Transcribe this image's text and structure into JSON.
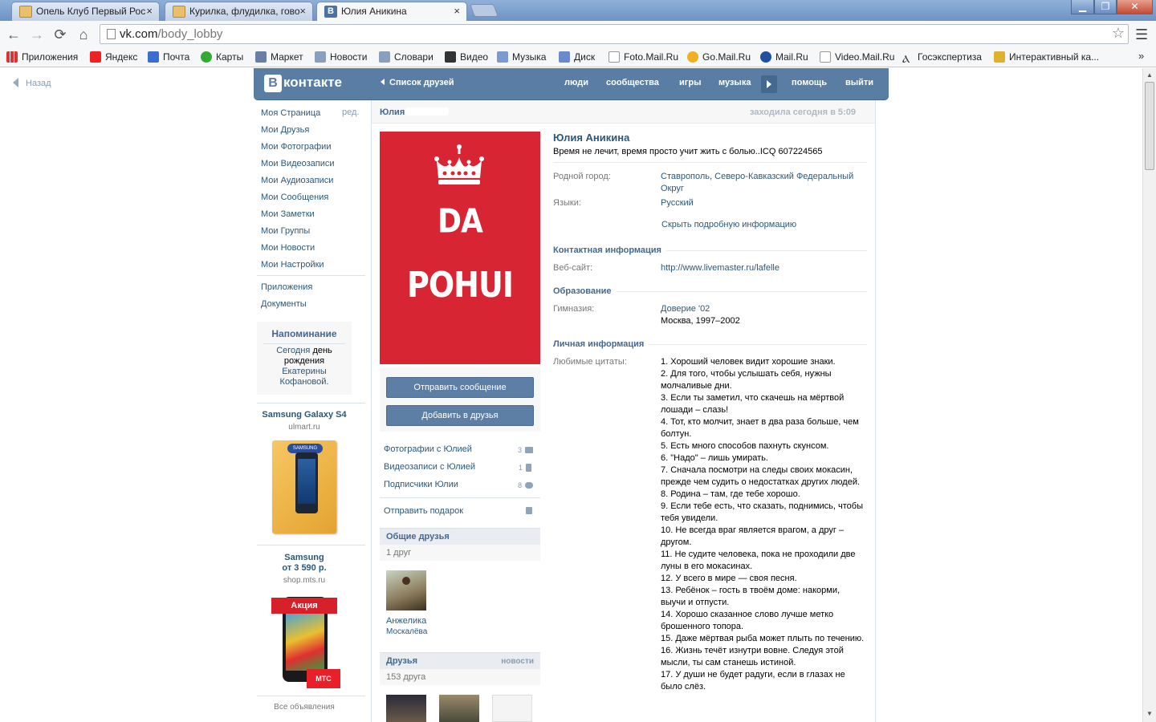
{
  "browser": {
    "tabs": [
      {
        "title": "Опель Клуб Первый Рос"
      },
      {
        "title": "Курилка, флудилка, гово"
      },
      {
        "title": "Юлия Аникина"
      }
    ],
    "url_host": "vk.com",
    "url_path": "/body_lobby",
    "bookmarks": [
      "Приложения",
      "Яндекс",
      "Почта",
      "Карты",
      "Маркет",
      "Новости",
      "Словари",
      "Видео",
      "Музыка",
      "Диск",
      "Foto.Mail.Ru",
      "Go.Mail.Ru",
      "Mail.Ru",
      "Video.Mail.Ru",
      "Госэкспертиза",
      "Интерактивный ка..."
    ],
    "bookmarks_more": "»"
  },
  "page": {
    "back_label": "Назад",
    "logo_text": "контакте",
    "logo_letter": "В",
    "friends_list_link": "Список друзей",
    "top_nav": [
      "люди",
      "сообщества",
      "игры",
      "музыка",
      "помощь",
      "выйти"
    ],
    "left_nav": [
      "Моя Страница",
      "Мои Друзья",
      "Мои Фотографии",
      "Мои Видеозаписи",
      "Мои Аудиозаписи",
      "Мои Сообщения",
      "Мои Заметки",
      "Мои Группы",
      "Мои Новости",
      "Мои Настройки"
    ],
    "edit_link": "ред.",
    "left_nav_extra": [
      "Приложения",
      "Документы"
    ],
    "reminder": {
      "title": "Напоминание",
      "today": "Сегодня",
      "text": "день рождения",
      "name1": "Екатерины",
      "name2": "Кофановой."
    },
    "ads": [
      {
        "title": "Samsung Galaxy S4",
        "domain": "ulmart.ru",
        "brand": "SAMSUNG"
      },
      {
        "title_line1": "Samsung",
        "title_line2": "от 3 590 р.",
        "domain": "shop.mts.ru",
        "banner": "Акция",
        "mts": "МТС"
      }
    ],
    "all_ads": "Все объявления",
    "crumb_name": "Юлия",
    "last_seen": "заходила сегодня в 5:09",
    "avatar_text": [
      "DA",
      "POHUI"
    ],
    "buttons": {
      "message": "Отправить сообщение",
      "add_friend": "Добавить в друзья"
    },
    "side_links": [
      {
        "label": "Фотографии с Юлией",
        "count": "3"
      },
      {
        "label": "Видеозаписи с Юлией",
        "count": "1"
      },
      {
        "label": "Подписчики Юлии",
        "count": "8"
      }
    ],
    "gift_link": "Отправить подарок",
    "mutual": {
      "title": "Общие друзья",
      "count": "1 друг",
      "friend_first": "Анжелика",
      "friend_last": "Москалёва"
    },
    "friends": {
      "title": "Друзья",
      "right": "новости",
      "count": "153 друга"
    },
    "profile": {
      "name": "Юлия Аникина",
      "status": "Время не лечит, время просто учит жить с болью..ICQ 607224565",
      "hometown_label": "Родной город:",
      "hometown_line1": "Ставрополь, Северо-Кавказский Федеральный",
      "hometown_line2": "Округ",
      "languages_label": "Языки:",
      "languages_value": "Русский",
      "hide_info": "Скрыть подробную информацию",
      "contact_title": "Контактная информация",
      "website_label": "Веб-сайт:",
      "website_value": "http://www.livemaster.ru/lafelle",
      "education_title": "Образование",
      "gymnasium_label": "Гимназия:",
      "gymnasium_value": "Доверие '02",
      "gymnasium_city": "Москва, 1997–2002",
      "personal_title": "Личная информация",
      "quotes_label": "Любимые цитаты:",
      "quotes": [
        "1. Хороший человек видит хорошие знаки.",
        "2. Для того, чтобы услышать себя, нужны молчаливые дни.",
        "3. Если ты заметил, что скачешь на мёртвой лошади – слазь!",
        "4. Тот, кто молчит, знает в два раза больше, чем болтун.",
        "5. Есть много способов пахнуть скунсом.",
        "6. \"Надо\" – лишь умирать.",
        "7. Сначала посмотри на следы своих мокасин, прежде чем судить о недостатках других людей.",
        "8. Родина – там, где тебе хорошо.",
        "9. Если тебе есть, что сказать, поднимись, чтобы тебя увидели.",
        "10. Не всегда враг является врагом, а друг – другом.",
        "11. Не судите человека, пока не проходили две луны в его мокасинах.",
        "12. У всего в мире — своя песня.",
        "13. Ребёнок – гость в твоём доме: накорми, выучи и отпусти.",
        "14. Хорошо сказанное слово лучше метко брошенного топора.",
        "15. Даже мёртвая рыба может плыть по течению.",
        "16. Жизнь течёт изнутри вовне. Следуя этой мысли, ты сам станешь истиной.",
        "17. У души не будет радуги, если в глазах не было слёз."
      ]
    }
  }
}
